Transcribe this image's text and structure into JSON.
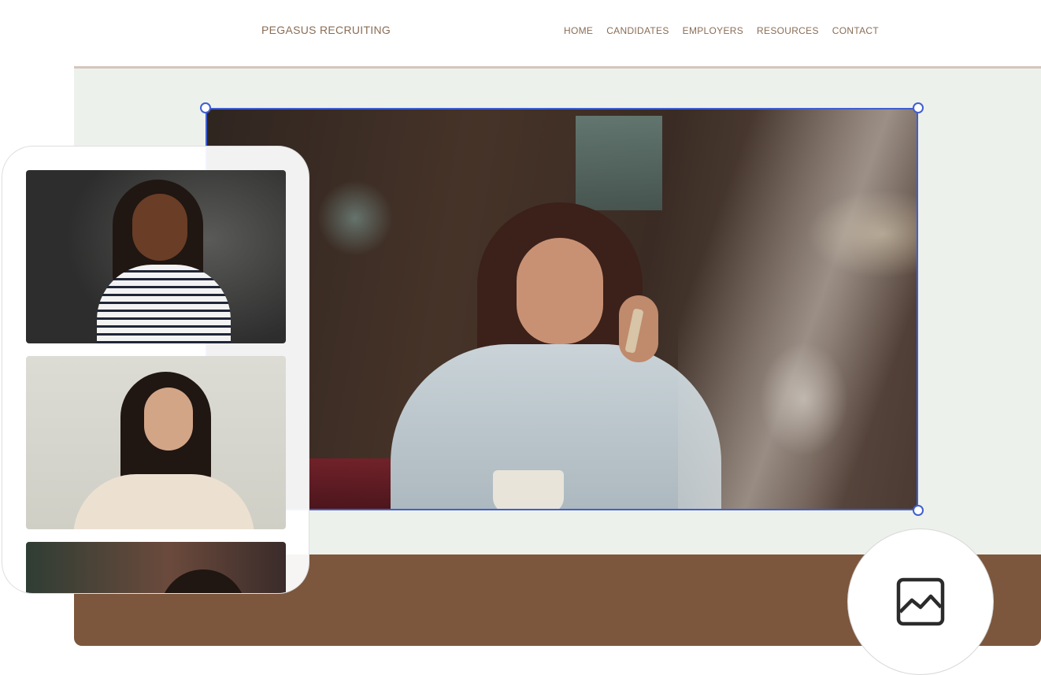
{
  "header": {
    "brand": "PEGASUS RECRUITING",
    "nav": [
      {
        "label": "HOME"
      },
      {
        "label": "CANDIDATES"
      },
      {
        "label": "EMPLOYERS"
      },
      {
        "label": "RESOURCES"
      },
      {
        "label": "CONTACT"
      }
    ]
  },
  "colors": {
    "accent_text": "#8a6d55",
    "canvas_bg": "#edf1ec",
    "footer_band": "#7c573d",
    "selection": "#3f5fd1"
  },
  "icons": {
    "media_button": "image-icon"
  }
}
